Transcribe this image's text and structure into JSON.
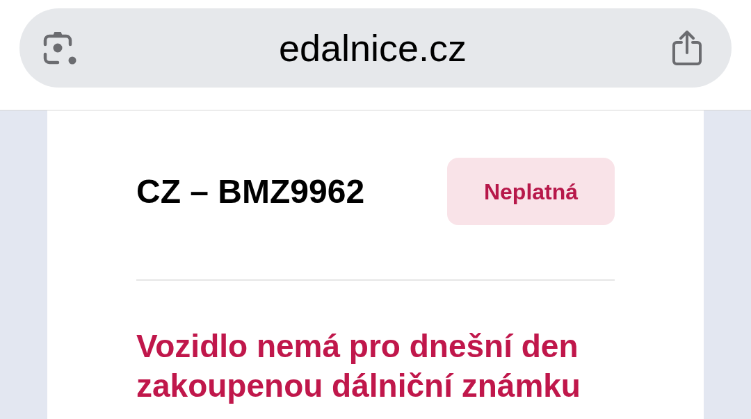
{
  "browser": {
    "url": "edalnice.cz"
  },
  "vignette_check": {
    "plate": "CZ – BMZ9962",
    "status_badge": "Neplatná",
    "message": "Vozidlo nemá pro dnešní den zakoupenou dálniční známku"
  }
}
